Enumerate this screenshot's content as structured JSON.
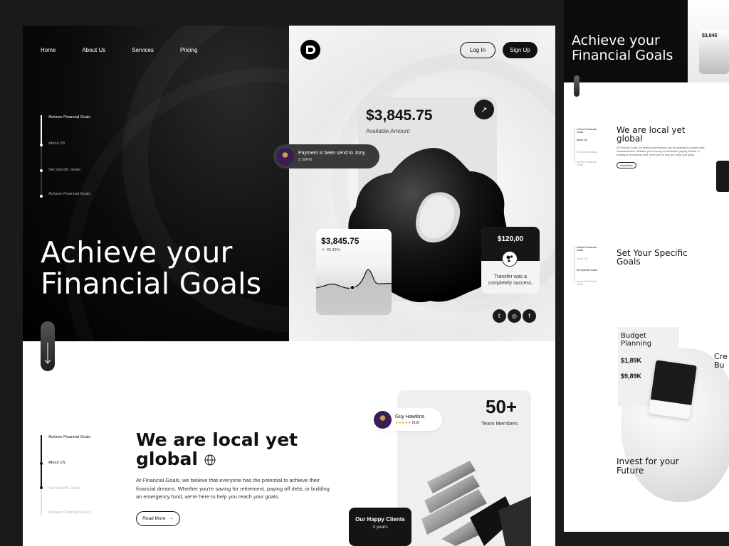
{
  "nav": {
    "items": [
      "Home",
      "About Us",
      "Services",
      "Pricing"
    ]
  },
  "auth": {
    "login": "Log In",
    "signup": "Sign Up"
  },
  "hero": {
    "steps": [
      "Achieve Financial Goals",
      "About US",
      "Set Specific Goals",
      "Achieve Financial Goals"
    ],
    "title_line1": "Achieve your",
    "title_line2": "Financial Goals"
  },
  "balance": {
    "amount": "$3,845.75",
    "label": "Available Amount"
  },
  "payment": {
    "title": "Payment is been send to Jony",
    "time": "2:30PM"
  },
  "chart_card": {
    "amount": "$3,845.75",
    "delta": "↗ -25.42%"
  },
  "transfer": {
    "amount": "$120,00",
    "message": "Transfer was a completely success."
  },
  "socials": [
    "twitter-icon",
    "instagram-icon",
    "facebook-icon"
  ],
  "about": {
    "steps": [
      "Achieve Financial Goals",
      "About US",
      "Set Specific Goals",
      "Achieve Financial Goals"
    ],
    "title_line1": "We are local yet",
    "title_line2": "global",
    "body": "At Financial Goals, we believe that everyone has the potential to achieve their financial dreams. Whether you're saving for retirement, paying off debt, or building an emergency fund, we're here to help you reach your goals.",
    "read_more": "Read More"
  },
  "members": {
    "count": "50+",
    "label": "Team Members"
  },
  "reviewer": {
    "name": "Guy Hawkins",
    "stars": "★★★★★",
    "score": "(5.0)"
  },
  "clients": {
    "title": "Our Happy Clients",
    "subtitle": "3 years"
  },
  "side": {
    "hero_line1": "Achieve your",
    "hero_line2": "Financial Goals",
    "hero_amount": "$3,845",
    "steps_a": [
      "Achieve Financial Goals",
      "About US",
      "Set Specific Goals",
      "Achieve Financial Goals"
    ],
    "about_title_line1": "We are local yet",
    "about_title_line2": "global",
    "read_more": "Read More",
    "specific_title_line1": "Set Your Specific",
    "specific_title_line2": "Goals",
    "budget_title_line1": "Budget",
    "budget_title_line2": "Planning",
    "budget_v1": "$1,89K",
    "budget_v2": "$9,89K",
    "create_line1": "Cre",
    "create_line2": "Bu",
    "invest_line1": "Invest for your",
    "invest_line2": "Future"
  },
  "colors": {
    "dark": "#111111",
    "accent_star": "#e3a500",
    "card_gray": "#e4e4e4"
  }
}
